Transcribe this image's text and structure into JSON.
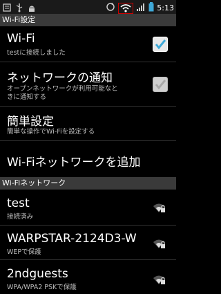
{
  "status_bar": {
    "time": "5:13",
    "icons": [
      "notification-icon",
      "usb-icon",
      "android-icon",
      "sync-icon",
      "wifi-icon",
      "signal-icon",
      "battery-icon"
    ]
  },
  "header": {
    "title": "Wi-Fi設定"
  },
  "settings": {
    "wifi": {
      "title": "Wi-Fi",
      "summary": "testに接続しました",
      "checked": true
    },
    "notify": {
      "title": "ネットワークの通知",
      "summary_line1": "オープンネットワークが利用可能なと",
      "summary_line2": "きに通知する",
      "checked": true
    },
    "easy": {
      "title": "簡単設定",
      "summary": "簡単な操作でWi-Fiを設定する"
    },
    "add": {
      "title": "Wi-Fiネットワークを追加"
    }
  },
  "networks_header": {
    "title": "Wi-Fiネットワーク"
  },
  "networks": [
    {
      "name": "test",
      "status": "接続済み",
      "icon": "wifi-lock-icon"
    },
    {
      "name": "WARPSTAR-2124D3-W",
      "status": "WEPで保護",
      "icon": "wifi-lock-icon"
    },
    {
      "name": "2ndguests",
      "status": "WPA/WPA2 PSKで保護",
      "icon": "wifi-lock-icon"
    }
  ],
  "colors": {
    "accent_check": "#3fa9d8",
    "section_bg": "#3a3a3a",
    "status_wifi_box": "#cc0000"
  }
}
